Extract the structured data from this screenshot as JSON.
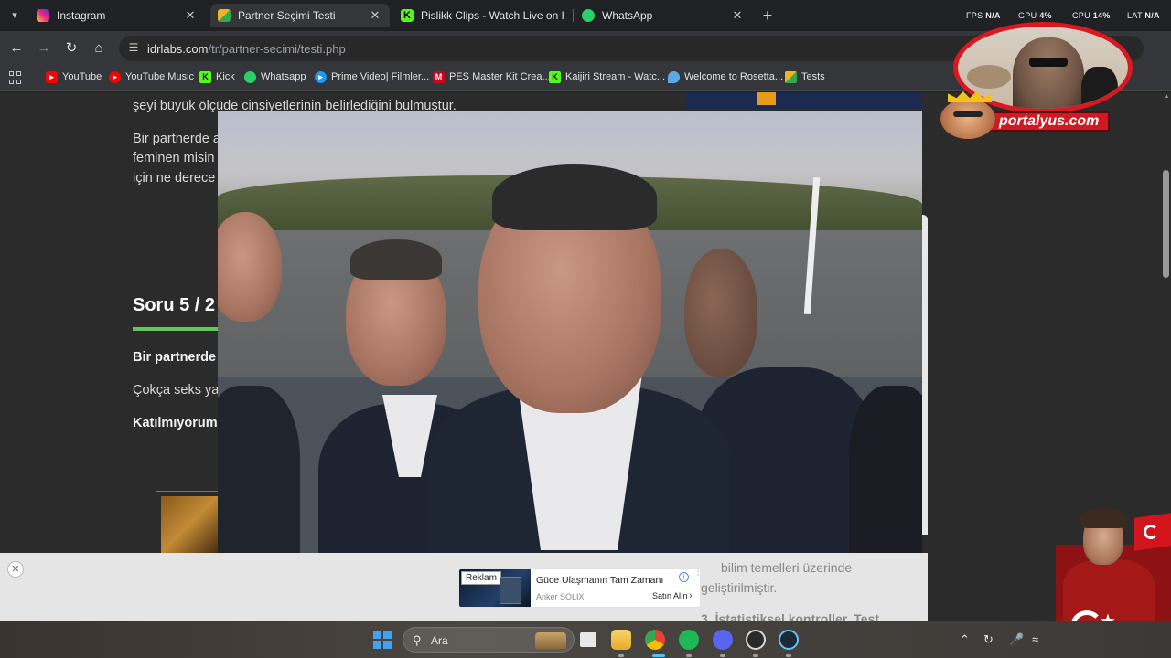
{
  "browser": {
    "tabs": [
      {
        "title": "Instagram",
        "favicon": "instagram-icon",
        "color": "#d62976",
        "active": false
      },
      {
        "title": "Partner Seçimi Testi",
        "favicon": "idrlabs-icon",
        "color": "#f3b41b",
        "active": true
      },
      {
        "title": "Pislikk Clips - Watch Live on Kick",
        "favicon": "kick-icon",
        "color": "#53fc18",
        "active": false
      },
      {
        "title": "WhatsApp",
        "favicon": "whatsapp-icon",
        "color": "#25d366",
        "active": false
      }
    ],
    "stats": {
      "fps_label": "FPS",
      "fps_value": "N/A",
      "gpu_label": "GPU",
      "gpu_value": "4%",
      "cpu_label": "CPU",
      "cpu_value": "14%",
      "lat_label": "LAT",
      "lat_value": "N/A"
    },
    "url_host": "idrlabs.com",
    "url_path": "/tr/partner-secimi/testi.php",
    "bookmarks": [
      {
        "label": "YouTube",
        "icon": "youtube-icon",
        "color": "#ff0000"
      },
      {
        "label": "YouTube Music",
        "icon": "youtube-music-icon",
        "color": "#ff0000"
      },
      {
        "label": "Kick",
        "icon": "kick-icon",
        "color": "#53fc18"
      },
      {
        "label": "Whatsapp",
        "icon": "whatsapp-icon",
        "color": "#25d366"
      },
      {
        "label": "Prime Video| Filmler...",
        "icon": "prime-video-icon",
        "color": "#1a98ff"
      },
      {
        "label": "PES Master Kit Crea...",
        "icon": "pes-master-icon",
        "color": "#d0021b"
      },
      {
        "label": "Kaijiri Stream - Watc...",
        "icon": "kick-icon",
        "color": "#53fc18"
      },
      {
        "label": "Welcome to Rosetta...",
        "icon": "rosetta-icon",
        "color": "#5aa9e6"
      },
      {
        "label": "Tests",
        "icon": "idrlabs-icon",
        "color": "#f3b41b"
      }
    ]
  },
  "page": {
    "line1": "şeyi büyük ölçüde cinsiyetlerinin belirlediğini bulmuştur.",
    "para_line1": "Bir partnerde a",
    "para_line2": "feminen misin",
    "para_line3": "için ne derece",
    "question_heading": "Soru 5 / 2",
    "question_text": "Bir partnerde",
    "option_text": "Çokça seks yap",
    "option_answer": "Katılmıyorum"
  },
  "overlay": {
    "brand_name": "portalyus.com"
  },
  "ad": {
    "label": "Reklam",
    "title": "Güce Ulaşmanın Tam Zamanı",
    "brand": "Anker SOLIX",
    "cta": "Satın Alın",
    "ghost_line1": "bilim temelleri üzerinde",
    "ghost_line2": "geliştirilmiştir.",
    "ghost_line3": "3. İstatistiksel kontroller. Test"
  },
  "taskbar": {
    "search_placeholder": "Ara",
    "pinned": [
      {
        "name": "widgets-icon",
        "color": "#c9a26a"
      },
      {
        "name": "task-view-icon",
        "color": "#e8e8e8"
      },
      {
        "name": "file-explorer-icon",
        "color": "#f5c344"
      },
      {
        "name": "chrome-icon",
        "color": "#4285f4"
      },
      {
        "name": "spotify-icon",
        "color": "#1db954"
      },
      {
        "name": "discord-icon",
        "color": "#5865f2"
      },
      {
        "name": "obs-icon",
        "color": "#d8d8d8"
      },
      {
        "name": "steam-icon",
        "color": "#1b2838"
      }
    ]
  }
}
